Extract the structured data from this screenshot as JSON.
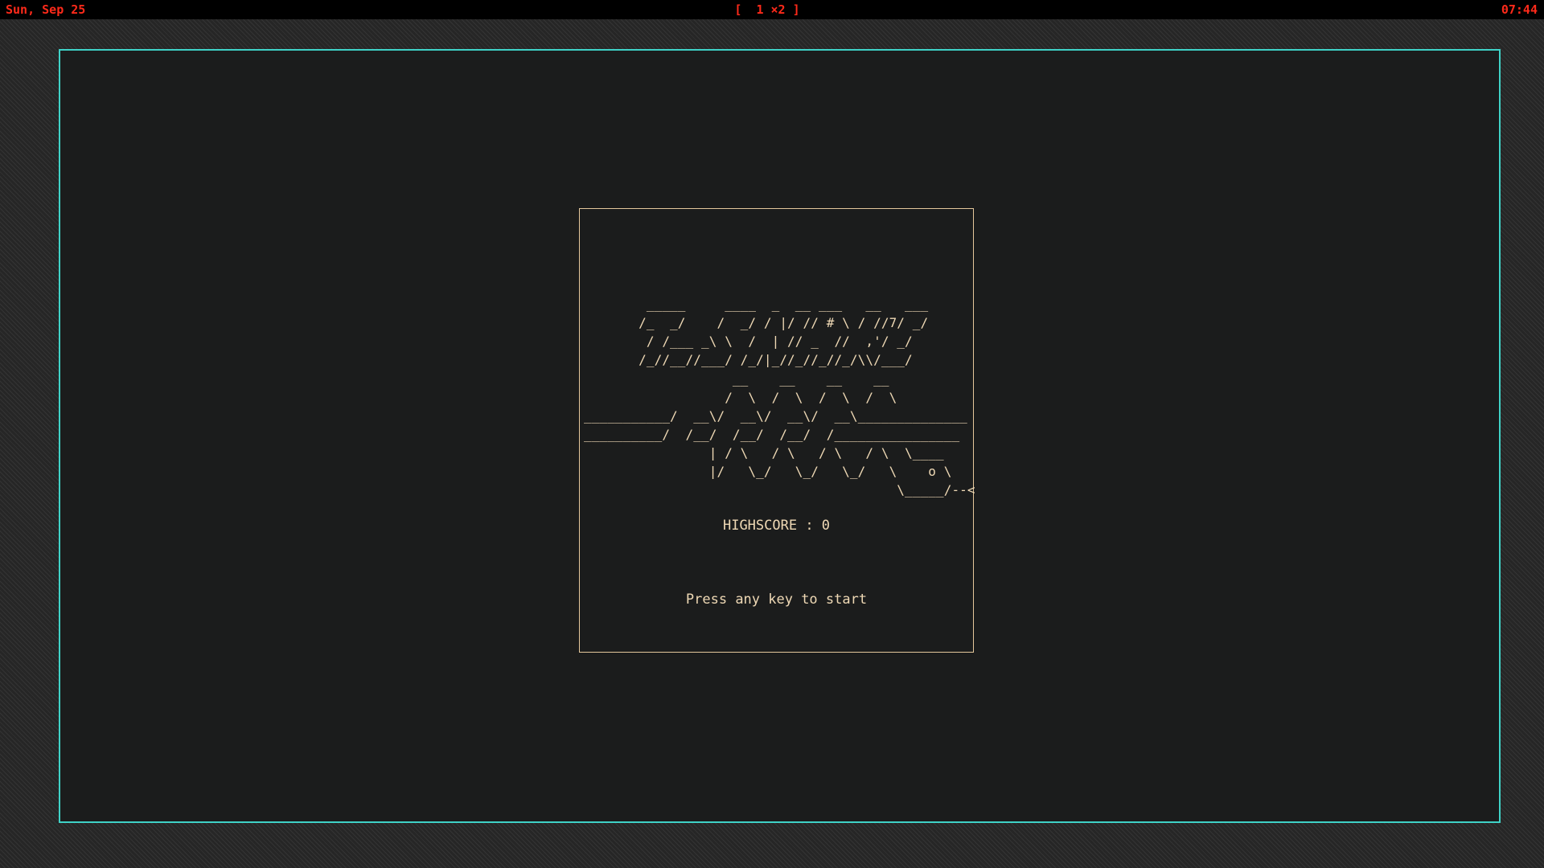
{
  "topbar": {
    "date": "Sun, Sep 25",
    "workspaces": "[  1 ×2 ]",
    "time": "07:44"
  },
  "game": {
    "title_ascii": "        _____     ____  _  __ ___   __   ___\n       /_  _/    /  _/ / |/ // # \\ / //7/ _/\n        / /___ _\\ \\  /  | // _  //  ,'/ _/\n       /_//__//___/ /_/|_//_//_//_/\\\\/___/",
    "art_ascii": "                   __    __    __    __\n                  /  \\  /  \\  /  \\  /  \\\n___________/  __\\/  __\\/  __\\/  __\\______________\n__________/  /__/  /__/  /__/  /________________\n                | / \\   / \\   / \\   / \\  \\____\n                |/   \\_/   \\_/   \\_/   \\    o \\\n                                        \\_____/--<",
    "highscore": "HIGHSCORE : 0",
    "start_message": "Press any key to start"
  },
  "colors": {
    "bar_text": "#ff2a1a",
    "window_border": "#3fd2c7",
    "game_text": "#efd9b5"
  }
}
